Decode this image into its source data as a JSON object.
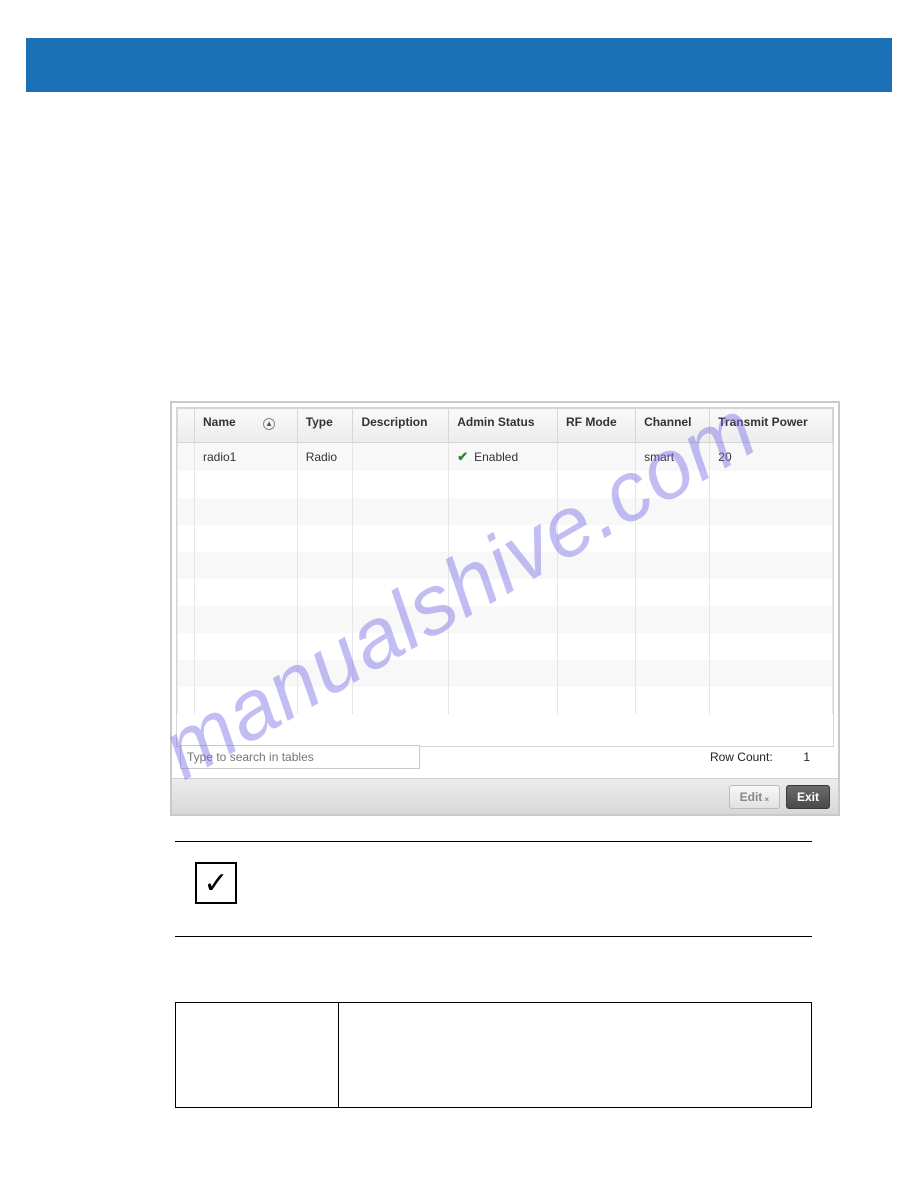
{
  "watermark": "manualshive.com",
  "table": {
    "headers": [
      "Name",
      "Type",
      "Description",
      "Admin Status",
      "RF Mode",
      "Channel",
      "Transmit Power"
    ],
    "rows": [
      {
        "name": "radio1",
        "type": "Radio",
        "description": "",
        "admin_status": "Enabled",
        "rf_mode": "",
        "channel": "smart",
        "transmit_power": "20"
      }
    ]
  },
  "search": {
    "placeholder": "Type to search in tables"
  },
  "row_count": {
    "label": "Row Count:",
    "value": "1"
  },
  "buttons": {
    "edit": "Edit",
    "exit": "Exit"
  }
}
